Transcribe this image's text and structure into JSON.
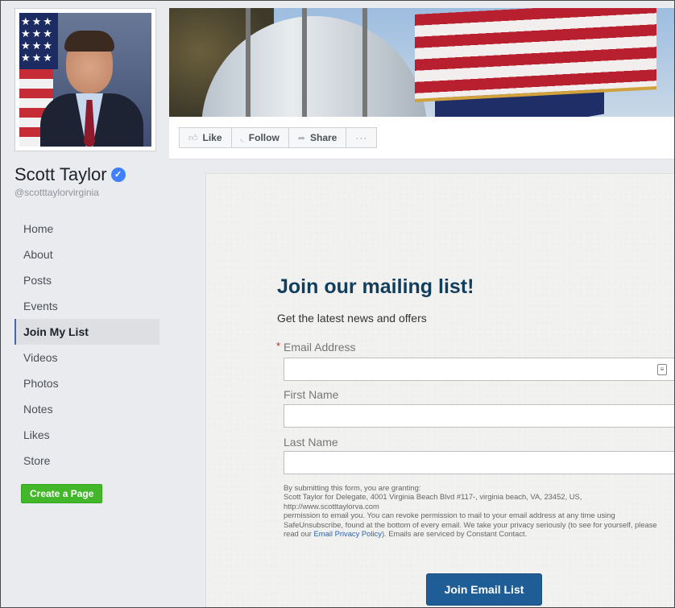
{
  "page": {
    "name": "Scott Taylor",
    "handle": "@scotttaylorvirginia",
    "verified": true
  },
  "actions": {
    "like": "Like",
    "follow": "Follow",
    "share": "Share",
    "more": "···"
  },
  "nav": {
    "items": [
      {
        "label": "Home"
      },
      {
        "label": "About"
      },
      {
        "label": "Posts"
      },
      {
        "label": "Events"
      },
      {
        "label": "Join My List",
        "active": true
      },
      {
        "label": "Videos"
      },
      {
        "label": "Photos"
      },
      {
        "label": "Notes"
      },
      {
        "label": "Likes"
      },
      {
        "label": "Store"
      }
    ],
    "create_page": "Create a Page"
  },
  "form": {
    "title": "Join our mailing list!",
    "subtitle": "Get the latest news and offers",
    "required_marker": "*",
    "email_label": "Email Address",
    "email_value": "",
    "first_name_label": "First Name",
    "first_name_value": "",
    "last_name_label": "Last Name",
    "last_name_value": "",
    "disclaimer_1": "By submitting this form, you are granting:",
    "disclaimer_2": "Scott Taylor for Delegate, 4001 Virginia Beach Blvd #117-, virginia beach, VA, 23452, US, http://www.scotttaylorva.com",
    "disclaimer_3": "permission to email you. You can revoke permission to mail to your email address at any time using SafeUnsubscribe, found at the bottom of every email. We take your privacy seriously (to see for yourself, please read our ",
    "privacy_link": "Email Privacy Policy",
    "disclaimer_4": "). Emails are serviced by Constant Contact.",
    "submit": "Join Email List"
  },
  "colors": {
    "accent": "#4267b2",
    "verified": "#4080ff",
    "create_page": "#42b72a",
    "form_title": "#123e5e",
    "submit": "#1f5d96"
  }
}
